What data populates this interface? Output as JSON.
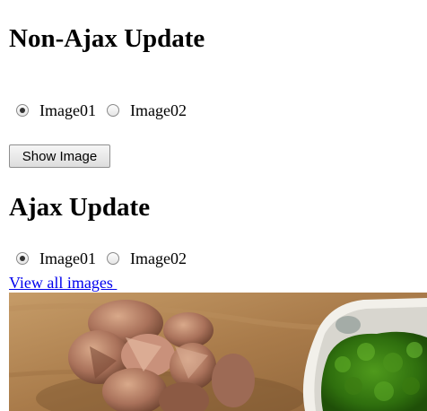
{
  "non_ajax": {
    "title": "Non-Ajax Update",
    "options": [
      {
        "label": "Image01",
        "checked": true
      },
      {
        "label": "Image02",
        "checked": false
      }
    ],
    "button_label": "Show Image"
  },
  "ajax": {
    "title": "Ajax Update",
    "options": [
      {
        "label": "Image01",
        "checked": true
      },
      {
        "label": "Image02",
        "checked": false
      }
    ],
    "link_text": "View all images "
  },
  "photo": {
    "subject": "pinecone-and-broccoli-photo"
  },
  "colors": {
    "link": "#0000ee",
    "background": "#ffffff"
  }
}
